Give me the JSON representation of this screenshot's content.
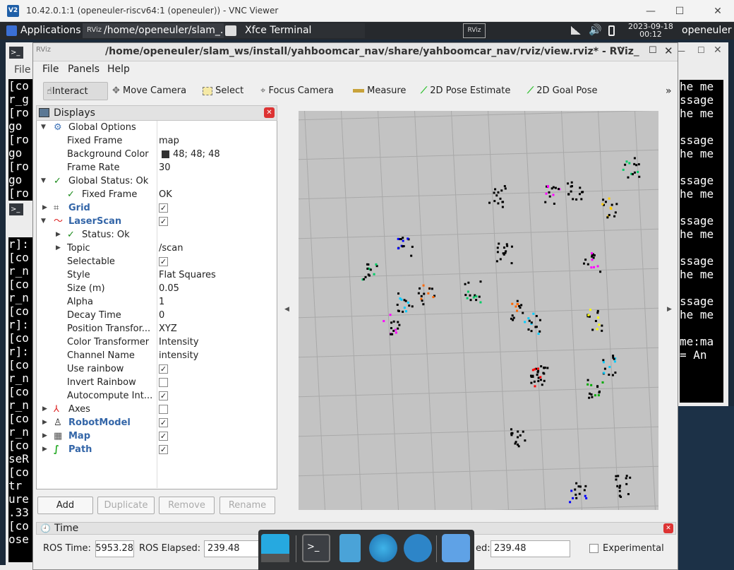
{
  "vnc": {
    "title": "10.42.0.1:1 (openeuler-riscv64:1 (openeuler)) - VNC Viewer",
    "logo": "V2"
  },
  "panel": {
    "applications": "Applications",
    "task1": "/home/openeuler/slam_...",
    "task2": "Xfce Terminal",
    "task3_badge": "RViz",
    "date": "2023-09-18",
    "time": "00:12",
    "user": "openeuler"
  },
  "bg_terminal_left": {
    "lines_top": [
      "File",
      "[co",
      "r_g",
      "[ro",
      " go",
      "[ro",
      " go",
      "[ro",
      " go",
      "[ro"
    ],
    "lines_bottom": [
      "r]:",
      "[co",
      "r_n",
      "[co",
      "r_n",
      "[co",
      "r]:",
      "[co",
      "r]:",
      "[co",
      "r_n",
      "[co",
      "r_n",
      "[co",
      "r_n",
      "[co",
      "seR",
      "[co",
      " tr",
      "ure",
      ".33",
      "[co",
      "ose"
    ]
  },
  "bg_terminal_right": {
    "lines": [
      "he me",
      "",
      "ssage",
      "he me",
      "",
      "ssage",
      "he me",
      "",
      "ssage",
      "he me",
      "",
      "ssage",
      "he me",
      "",
      "ssage",
      "he me",
      "",
      "ssage",
      "he me",
      "",
      "me:ma",
      " = An"
    ]
  },
  "rviz": {
    "title": "/home/openeuler/slam_ws/install/yahboomcar_nav/share/yahboomcar_nav/rviz/view.rviz* - RViz",
    "menu": [
      "File",
      "Panels",
      "Help"
    ],
    "toolbar": {
      "interact": "Interact",
      "move_camera": "Move Camera",
      "select": "Select",
      "focus_camera": "Focus Camera",
      "measure": "Measure",
      "pose_estimate": "2D Pose Estimate",
      "goal_pose": "2D Goal Pose",
      "overflow": "»"
    },
    "displays": {
      "title": "Displays",
      "rows": [
        {
          "label": "Global Options",
          "value": ""
        },
        {
          "label": "Fixed Frame",
          "value": "map"
        },
        {
          "label": "Background Color",
          "value": "48; 48; 48"
        },
        {
          "label": "Frame Rate",
          "value": "30"
        },
        {
          "label": "Global Status: Ok",
          "value": ""
        },
        {
          "label": "Fixed Frame",
          "value": "OK"
        },
        {
          "label": "Grid",
          "value": ""
        },
        {
          "label": "LaserScan",
          "value": ""
        },
        {
          "label": "Status: Ok",
          "value": ""
        },
        {
          "label": "Topic",
          "value": "/scan"
        },
        {
          "label": "Selectable",
          "value": ""
        },
        {
          "label": "Style",
          "value": "Flat Squares"
        },
        {
          "label": "Size (m)",
          "value": "0.05"
        },
        {
          "label": "Alpha",
          "value": "1"
        },
        {
          "label": "Decay Time",
          "value": "0"
        },
        {
          "label": "Position Transfor...",
          "value": "XYZ"
        },
        {
          "label": "Color Transformer",
          "value": "Intensity"
        },
        {
          "label": "Channel Name",
          "value": "intensity"
        },
        {
          "label": "Use rainbow",
          "value": ""
        },
        {
          "label": "Invert Rainbow",
          "value": ""
        },
        {
          "label": "Autocompute Int...",
          "value": ""
        },
        {
          "label": "Axes",
          "value": ""
        },
        {
          "label": "RobotModel",
          "value": ""
        },
        {
          "label": "Map",
          "value": ""
        },
        {
          "label": "Path",
          "value": ""
        }
      ],
      "buttons": {
        "add": "Add",
        "duplicate": "Duplicate",
        "remove": "Remove",
        "rename": "Rename"
      }
    },
    "time": {
      "title": "Time",
      "ros_time_label": "ROS Time:",
      "ros_time_value": "5953.28",
      "ros_elapsed_label": "ROS Elapsed:",
      "ros_elapsed_value": "239.48",
      "wall_elapsed_label": "ed:",
      "wall_elapsed_value": "239.48",
      "experimental": "Experimental"
    },
    "bg_color": "#303030"
  }
}
